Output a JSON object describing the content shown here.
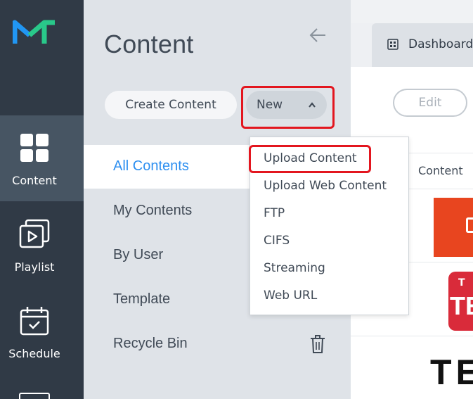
{
  "rail": {
    "items": [
      {
        "label": "Content",
        "icon": "grid-icon",
        "active": true
      },
      {
        "label": "Playlist",
        "icon": "playlist-icon",
        "active": false
      },
      {
        "label": "Schedule",
        "icon": "calendar-icon",
        "active": false
      }
    ]
  },
  "panel": {
    "title": "Content",
    "create_label": "Create Content",
    "new_label": "New",
    "nav": [
      {
        "label": "All Contents",
        "active": true
      },
      {
        "label": "My Contents",
        "active": false
      },
      {
        "label": "By User",
        "active": false
      },
      {
        "label": "Template",
        "active": false
      },
      {
        "label": "Recycle Bin",
        "active": false
      }
    ]
  },
  "main": {
    "tab_label": "Dashboard",
    "edit_label": "Edit",
    "column_header": "Content",
    "thumb2_line1": "T",
    "thumb2_line2": "TE",
    "thumb3_text": "TE"
  },
  "dropdown": {
    "items": [
      "Upload Content",
      "Upload Web Content",
      "FTP",
      "CIFS",
      "Streaming",
      "Web URL"
    ]
  },
  "colors": {
    "rail_bg": "#303a46",
    "accent_blue": "#2d8ff0",
    "highlight_red": "#e3161f",
    "logo_blue": "#2196f3",
    "logo_green": "#29c88a"
  }
}
